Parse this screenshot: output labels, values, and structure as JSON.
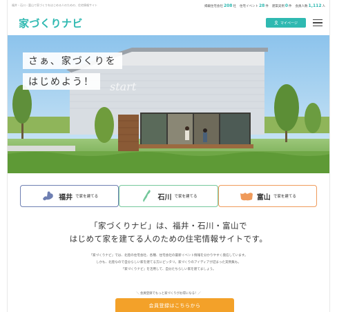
{
  "topbar": {
    "tagline": "福井・石川・富山で家づくりをはじめる人のための、住宅情報サイト",
    "stats": [
      {
        "label": "掲載住宅会社",
        "value": "208",
        "unit": "社"
      },
      {
        "label": "住宅イベント",
        "value": "28",
        "unit": "件"
      },
      {
        "label": "建築実例",
        "value": "0",
        "unit": "件"
      },
      {
        "label": "会員人数",
        "value": "1,112",
        "unit": "人"
      }
    ]
  },
  "header": {
    "logo": "家づくりナビ",
    "mypage_label": "マイページ"
  },
  "hero": {
    "line1": "さぁ、家づくりを",
    "line2": "はじめよう！",
    "script_text": "start"
  },
  "prefectures": [
    {
      "name": "福井",
      "tail": "で家を建てる"
    },
    {
      "name": "石川",
      "tail": "で家を建てる"
    },
    {
      "name": "富山",
      "tail": "で家を建てる"
    }
  ],
  "intro": {
    "title_line1": "「家づくりナビ」は、福井・石川・富山で",
    "title_line2": "はじめて家を建てる人のための住宅情報サイトです。",
    "body_line1": "「家づくりナビ」では、北陸の住宅会社、各種、住宅会社の最新イベント情報を分かりやすく発信しています。",
    "body_line2": "しかも、北陸なので自分らしい家を建てる方にピッタリ。家づくりのアイディアが詰まった実例集も。",
    "body_line3": "「家づくりナビ」を活用して、自分たちらしい家を建てましょう。"
  },
  "signup": {
    "lead": "＼ 会員登録でもっと家づくりがお得になる！／",
    "button_label": "会員登録はこちらから"
  },
  "colors": {
    "brand": "#2fb9b1",
    "signup": "#f3a129",
    "fukui": "#6e7fb2",
    "ishikawa": "#74c79b",
    "toyama": "#ef9a5a"
  },
  "icons": {
    "mypage": "user-icon",
    "menu": "hamburger-menu-icon"
  }
}
